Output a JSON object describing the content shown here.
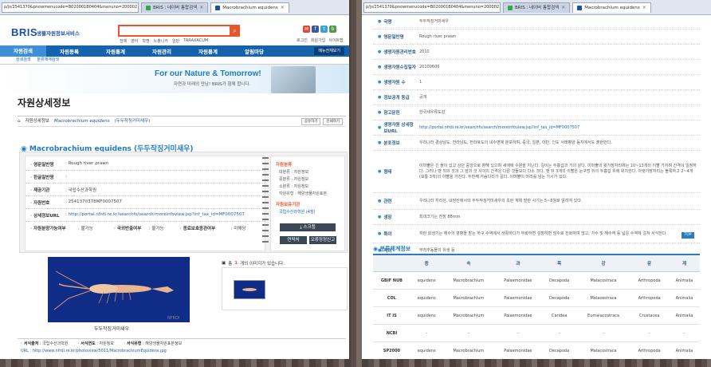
{
  "left": {
    "url": "p/js/2541370&pnowmenucode=B020001B0404&menuno=200002",
    "tabs": [
      {
        "label": "BRIS : 네이버 통합검색"
      },
      {
        "label": "Macrobrachium equidens"
      }
    ],
    "logo": {
      "brand": "BRIS",
      "subtitle": "생물자원정보서비스"
    },
    "search": {
      "button": "⌕"
    },
    "quicklinks": [
      "전체",
      "영어",
      "학명",
      "노출니카",
      "일반",
      "TARAXACUM"
    ],
    "toplinks": [
      "로그인",
      "회원가입",
      "사이트맵"
    ],
    "gnb": [
      "자원검색",
      "자원등록",
      "자원통계",
      "자원관리",
      "자원통계",
      "알림마당"
    ],
    "gnb_all": "메뉴전체보기",
    "subnav": [
      "상세검색",
      "분류체계검색"
    ],
    "banner": {
      "en": "For our Nature & Tomorrow!",
      "ko": "자연과 미래의 만남! BRIS가 함께 합니다."
    },
    "page_title": "자원상세정보",
    "breadcrumb": {
      "home": "⌂",
      "level1": "자원상세정보",
      "species": "Macrobrachium equidens",
      "korean": "(두두작징거미새우)"
    },
    "share": [
      "공유하기",
      "인쇄하기"
    ],
    "species_title": "Macrobrachium equidens (두두작징거미새우)",
    "fields": [
      {
        "label": "영문일반명",
        "value": ": Rough river prawn"
      },
      {
        "label": "한글일반명",
        "value": ":"
      },
      {
        "label": "제공기관",
        "value": ": 국립수산과학원"
      },
      {
        "label": "자원번호",
        "value": ": 2541370378MF0007507"
      },
      {
        "label": "상세정보URL",
        "value": ": http://portal.nfrdi.re.kr/searchfs/search/moreinfoview.jsp?inf_tax_id=MF0007507"
      },
      {
        "label": "자원분양가능여부",
        "value": ": 불가능"
      }
    ],
    "extra_fields": [
      {
        "label": "국외반출여부",
        "value": ": 불가능"
      },
      {
        "label": "종료보호종관여부",
        "value": ": 미해당"
      }
    ],
    "side": {
      "head1": "자원분류",
      "items": [
        "대분류 : 자원정보",
        "중분류 : 자원정보",
        "소분류 : 자원정보",
        "자원유형 : 해양생물자원표본"
      ],
      "head2": "자원보유기관",
      "org": "국립수산과학원 (4점)",
      "scrap": "스크랩",
      "btn_left": "연락처",
      "btn_right": "오류정정신고"
    },
    "image_caption": "두두작징거미새우",
    "image_count": {
      "prefix": "총",
      "count": "1",
      "suffix": "개의 이미지가 있습니다."
    },
    "bottom": [
      {
        "label": "서식출처",
        "value": ": 국립수산과학원"
      },
      {
        "label": "서식연도",
        "value": ": 자원정보"
      },
      {
        "label": "서식유형",
        "value": ": 해양생물자원표본정보"
      }
    ],
    "bottom_url": "URL : http://www.nfrdi.re.kr/photoview/5011/MacrobrachiumEquidens.jpg"
  },
  "right": {
    "url": "p/js/2541370&pnowmenucode=B020001B0404&menuno=200002",
    "tabs": [
      {
        "label": "BRIS : 네이버 통합검색"
      },
      {
        "label": "Macrobrachium equidens"
      }
    ],
    "rows": [
      {
        "label": "국명",
        "value": "두두작징거미새우"
      },
      {
        "label": "영문일반명",
        "value": "Rough river prawn"
      },
      {
        "label": "생명자원관리번호",
        "value": "2010"
      },
      {
        "label": "생명자원수집일자",
        "value": "20100606"
      },
      {
        "label": "생명자원 수",
        "value": "1"
      },
      {
        "label": "정보공개 등급",
        "value": "공개"
      },
      {
        "label": "참고문헌",
        "value": "한국새우류도감"
      },
      {
        "label": "생명자원 상세정보URL",
        "value": "http://portal.nfrdi.re.kr/searchfs/search/moreinfoview.jsp?inf_tax_id=MF0007507",
        "link": true
      },
      {
        "label": "분포정보",
        "value": "우리나라 경상남도, 전라남도, 전라북도의 내수면에 분포하며, 중국, 일본, 대만, 인도 서태평양 등지에서도 출현한다."
      },
      {
        "label": "형태",
        "value": "이마뿔은 긴 플이 있고 상단 중앙으로 향해 있으며 새애에 수분을 지닌다. 길이는 두흉갑과 거의 같다. 이마뿔의 윗가장자리에는 10~13개의 이빨 가지며 간격이 일정하다. 그러나 맨 뒤의 것과 그 앞의 것 사이의 간격은 다른 것들보다 다소 크다. 맨 뒤 3개의 이빨은 눈구멍 뒤의 두흉갑 위에 위치한다. 아랫가장자리는 볼록하고 2~4개 (보통 3개)의 이빨을 가진다. 두번째 가슴다리가 길다. 이마뿔이 머리를 넘는 가시가 있다."
      },
      {
        "label": "관련",
        "value": "우리나라 지리산, 내장산에서의 두두작징거미새우의 초란 계체 발란 시기는 5~8월로 알려져 있다."
      },
      {
        "label": "생장",
        "value": "최대크기는 전장 88mm"
      },
      {
        "label": "특이",
        "value": "저런 회생기는 해수의 영향을 받는 하구 수역에서 생활하다가 부화하면 성장하면 담수로 진화하며 많고, 가수 및 해수역 등 넓은 수역에 걸쳐 서식한다."
      },
      {
        "label": "먹이",
        "value": "무척추동물의 유생 등"
      }
    ],
    "top_button": "TOP",
    "section_title": "분류체계정보",
    "tax_headers": [
      "",
      "종",
      "속",
      "과",
      "목",
      "강",
      "문",
      "계"
    ],
    "tax_rows": [
      [
        "GBIF NUB",
        "equidens",
        "Macrobrachium",
        "Palaemonidae",
        "Decapoda",
        "Malacostraca",
        "Arthropoda",
        "Animalia"
      ],
      [
        "COL",
        "equidens",
        "Macrobrachium",
        "Palaemonidae",
        "Decapoda",
        "Malacostraca",
        "Arthropoda",
        "Animalia"
      ],
      [
        "IT IS",
        "equidens",
        "Macrobrachium",
        "Palaemonidae",
        "Caridea",
        "Eumalacostraca",
        "Crustacea",
        "Animalia"
      ],
      [
        "NCBI",
        "-",
        "-",
        "-",
        "-",
        "-",
        "-",
        "-"
      ],
      [
        "SP2000",
        "equidens",
        "Macrobrachium",
        "Palaemonidae",
        "Decapoda",
        "Malacostraca",
        "Arthropoda",
        "Animalia"
      ]
    ]
  }
}
